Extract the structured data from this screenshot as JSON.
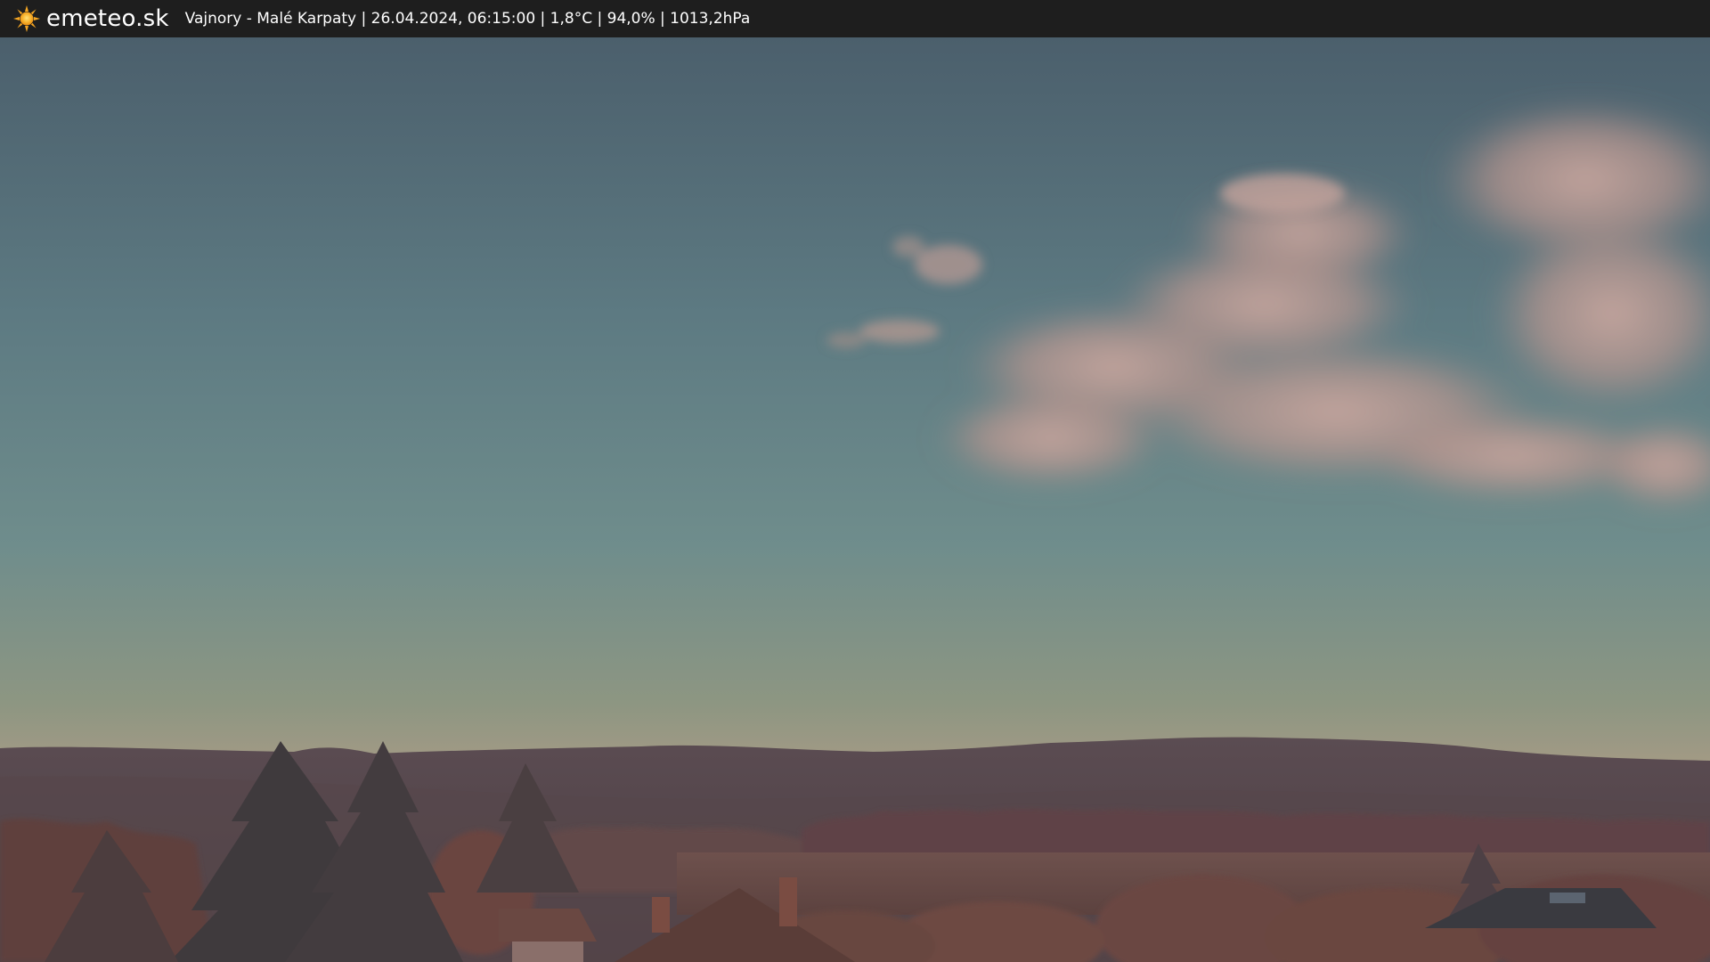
{
  "header": {
    "brand": "emeteo.sk",
    "caption": "Vajnory - Malé Karpaty | 26.04.2024, 06:15:00 | 1,8°C | 94,0% | 1013,2hPa",
    "logo_icon": "sun-icon",
    "logo_color": "#f5a623"
  },
  "colors": {
    "bar_background": "#1e1e1e",
    "sky_top": "#4e6470",
    "sky_mid": "#6b8a8c",
    "sky_horizon": "#b89a86",
    "mountains": "#5a4a4e",
    "foreground": "#6b4a44"
  }
}
